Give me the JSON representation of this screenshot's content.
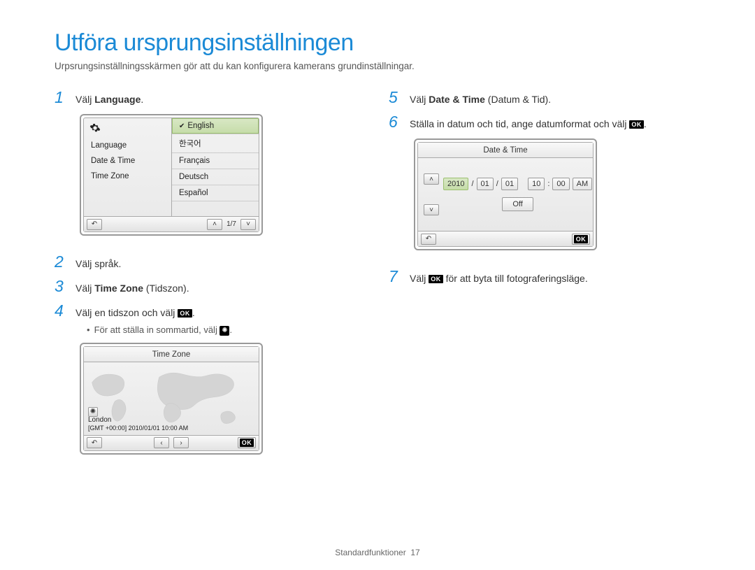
{
  "title": "Utföra ursprungsinställningen",
  "subtitle": "Urpsrungsinställningsskärmen gör att du kan konfigurera kamerans grundinställningar.",
  "steps": {
    "s1": {
      "prefix": "Välj ",
      "bold": "Language",
      "suffix": "."
    },
    "s2": {
      "text": "Välj språk."
    },
    "s3": {
      "prefix": "Välj ",
      "bold": "Time Zone",
      "suffix": " (Tidszon)."
    },
    "s4": {
      "prefix": "Välj en tidszon och välj ",
      "iconText": "OK",
      "suffix": "."
    },
    "bullet4": "För att ställa in sommartid, välj ",
    "s5": {
      "prefix": "Välj ",
      "bold": "Date & Time",
      "suffix": " (Datum & Tid)."
    },
    "s6": {
      "prefix": "Ställa in datum och tid, ange datumformat och välj ",
      "iconText": "OK",
      "suffix": "."
    },
    "s7": {
      "prefix": "Välj ",
      "iconText": "OK",
      "suffix": " för att byta till fotograferingsläge."
    }
  },
  "languageScreen": {
    "leftItems": [
      "Language",
      "Date & Time",
      "Time Zone"
    ],
    "rightItems": [
      "English",
      "한국어",
      "Français",
      "Deutsch",
      "Español"
    ],
    "selectedIndex": 0,
    "pager": "1/7"
  },
  "timezoneScreen": {
    "title": "Time Zone",
    "city": "London",
    "gmt": "[GMT +00:00] 2010/01/01 10:00 AM",
    "okLabel": "OK"
  },
  "datetimeScreen": {
    "title": "Date & Time",
    "year": "2010",
    "month": "01",
    "day": "01",
    "hour": "10",
    "minute": "00",
    "ampm": "AM",
    "off": "Off",
    "okLabel": "OK"
  },
  "footer": {
    "label": "Standardfunktioner",
    "page": "17"
  }
}
